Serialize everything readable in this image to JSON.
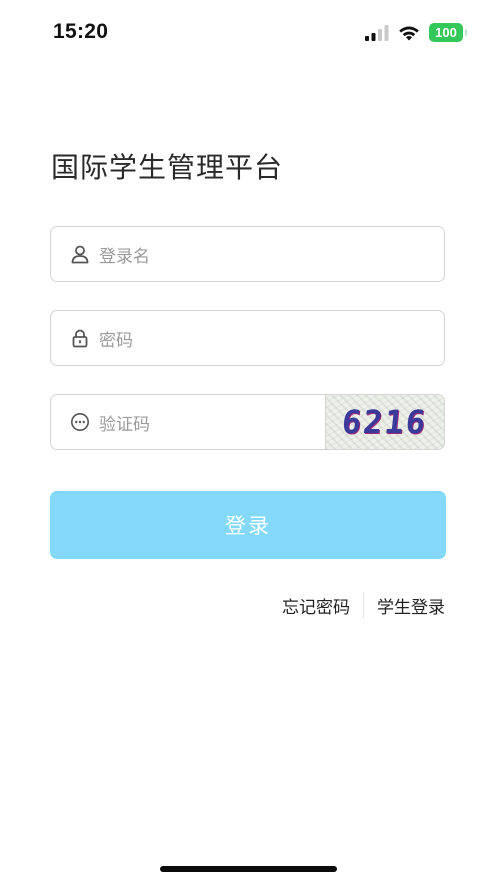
{
  "status_bar": {
    "time": "15:20",
    "battery": "100",
    "battery_color": "#34c759"
  },
  "title": "国际学生管理平台",
  "form": {
    "username_placeholder": "登录名",
    "password_placeholder": "密码",
    "captcha_placeholder": "验证码",
    "captcha_code": "6216",
    "username_icon": "user-icon",
    "password_icon": "lock-icon",
    "captcha_icon": "dots-circle-icon"
  },
  "login_button": {
    "label": "登录",
    "color": "#84d9fb"
  },
  "links": {
    "forgot_password": "忘记密码",
    "student_login": "学生登录"
  }
}
